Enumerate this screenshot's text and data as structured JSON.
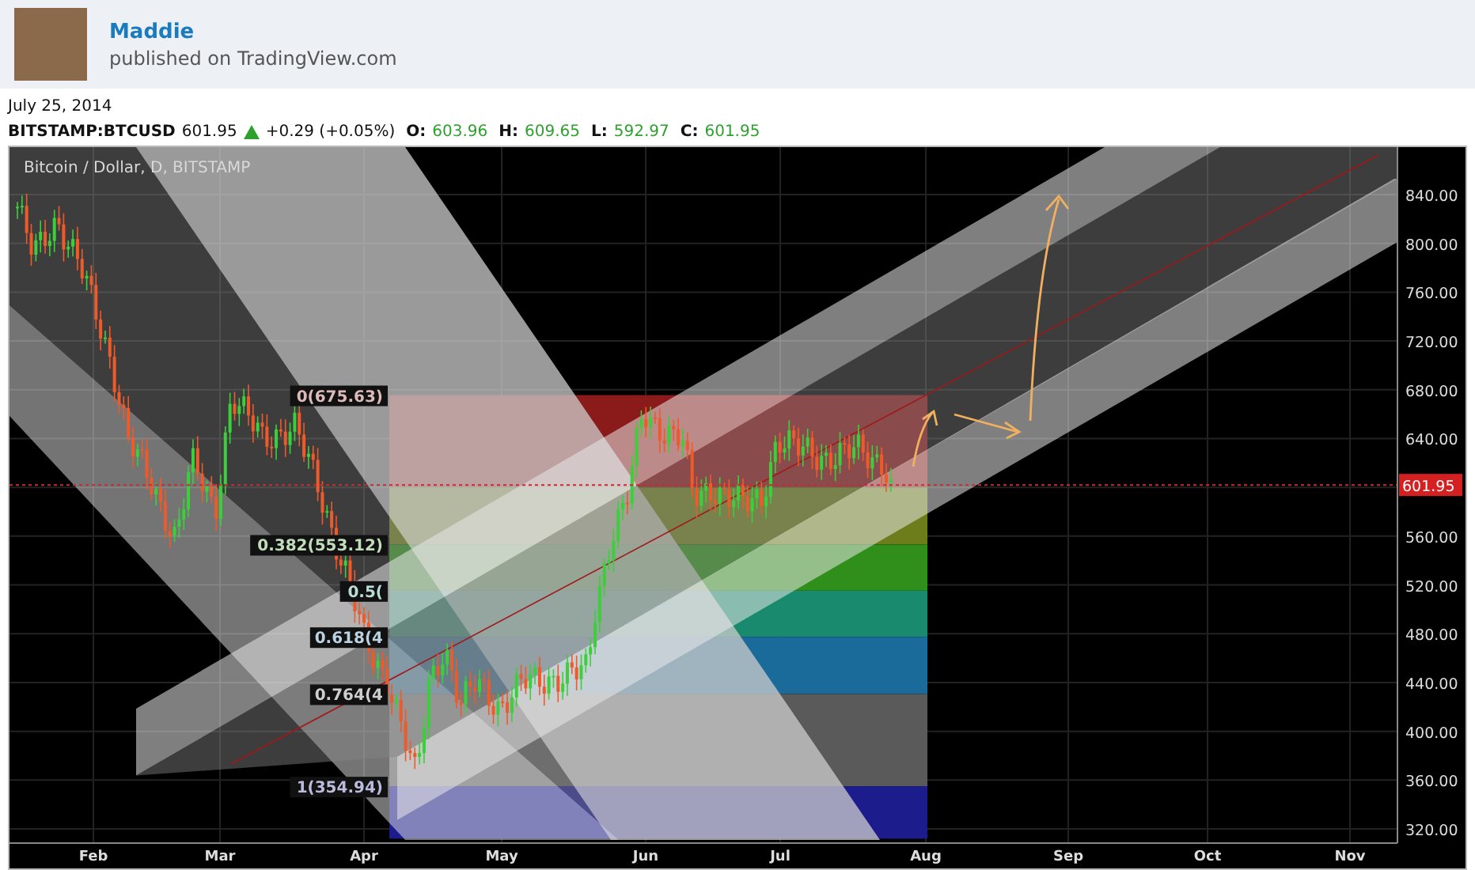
{
  "header": {
    "author": "Maddie",
    "published": "published on TradingView.com"
  },
  "date": "July 25, 2014",
  "quote": {
    "symbol": "BITSTAMP:BTCUSD",
    "last": "601.95",
    "change": "+0.29 (+0.05%)",
    "ohlc": [
      {
        "label": "O:",
        "value": "603.96"
      },
      {
        "label": "H:",
        "value": "609.65"
      },
      {
        "label": "L:",
        "value": "592.97"
      },
      {
        "label": "C:",
        "value": "601.95"
      }
    ]
  },
  "chart": {
    "title": "Bitcoin / Dollar, D, BITSTAMP",
    "price_axis": [
      "840.00",
      "800.00",
      "760.00",
      "720.00",
      "680.00",
      "640.00",
      "560.00",
      "520.00",
      "480.00",
      "440.00",
      "400.00",
      "360.00",
      "320.00"
    ],
    "last_price": "601.95",
    "time_axis": [
      "Feb",
      "Mar",
      "Apr",
      "May",
      "Jun",
      "Jul",
      "Aug",
      "Sep",
      "Oct",
      "Nov"
    ],
    "fib_levels": [
      {
        "label": "0(675.63)",
        "color": "#8b1a1a"
      },
      {
        "color": "#6e7d1c"
      },
      {
        "label": "0.382(553.12)",
        "color": "#2f8f1a"
      },
      {
        "label": "0.5(",
        "color": "#1a8a6e"
      },
      {
        "label": "0.618(4",
        "color": "#1a6a9a"
      },
      {
        "label": "0.764(4",
        "color": "#5a5a5a"
      },
      {
        "label": "1(354.94)",
        "color": "#1c1c8c"
      }
    ]
  }
}
